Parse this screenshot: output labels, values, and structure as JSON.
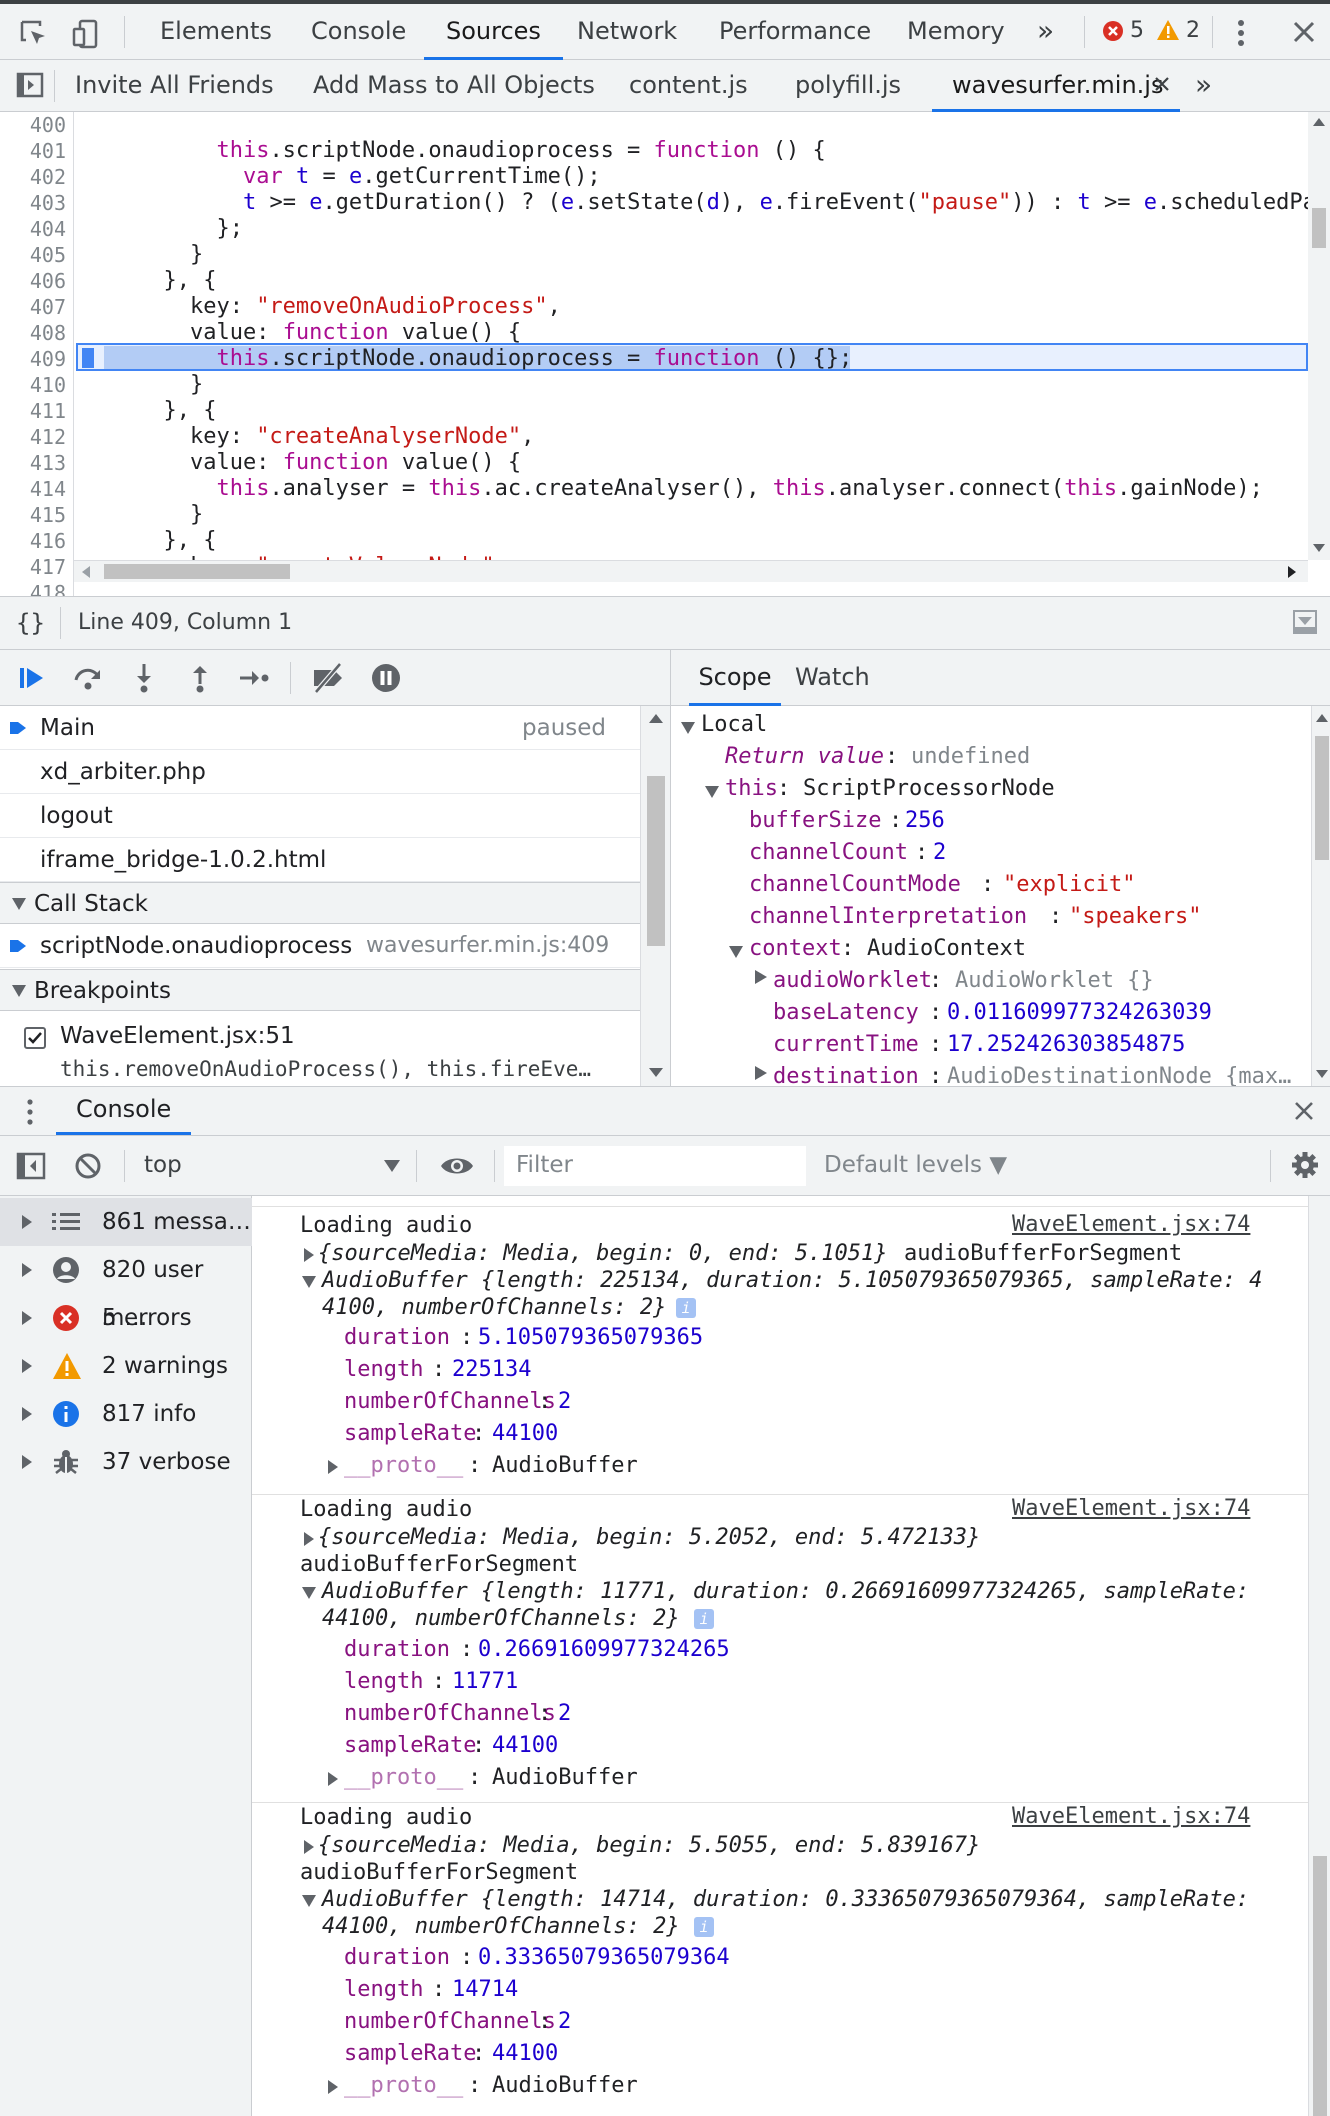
{
  "main_tabs": [
    "Elements",
    "Console",
    "Sources",
    "Network",
    "Performance",
    "Memory"
  ],
  "active_main_tab": "Sources",
  "toolbar": {
    "more_tabs": "»",
    "error_count": "5",
    "warning_count": "2"
  },
  "file_tabs": [
    "Invite All Friends",
    "Add Mass to All Objects",
    "content.js",
    "polyfill.js",
    "wavesurfer.min.js"
  ],
  "active_file_tab": "wavesurfer.min.js",
  "file_tabs_more": "»",
  "editor": {
    "line_numbers": [
      "400",
      "401",
      "402",
      "403",
      "404",
      "405",
      "406",
      "407",
      "408",
      "409",
      "410",
      "411",
      "412",
      "413",
      "414",
      "415",
      "416",
      "417",
      "418"
    ],
    "highlighted_line": "409"
  },
  "status": {
    "position": "Line 409, Column 1"
  },
  "threads": [
    {
      "name": "Main",
      "status": "paused"
    },
    {
      "name": "xd_arbiter.php",
      "status": ""
    },
    {
      "name": "logout",
      "status": ""
    },
    {
      "name": "iframe_bridge-1.0.2.html",
      "status": ""
    }
  ],
  "call_stack": {
    "title": "Call Stack",
    "frames": [
      {
        "function": "scriptNode.onaudioprocess",
        "location": "wavesurfer.min.js:409"
      }
    ]
  },
  "breakpoints": {
    "title": "Breakpoints",
    "items": [
      {
        "file": "WaveElement.jsx:51",
        "code": "this.removeOnAudioProcess(), this.fireEve…",
        "checked": true
      }
    ]
  },
  "scope_tabs": [
    "Scope",
    "Watch"
  ],
  "scope": {
    "local_label": "Local",
    "return_key": "Return value",
    "return_val": "undefined",
    "this_key": "this",
    "this_val": "ScriptProcessorNode",
    "props": [
      {
        "k": "bufferSize",
        "v": "256"
      },
      {
        "k": "channelCount",
        "v": "2"
      },
      {
        "k": "channelCountMode",
        "v": "\"explicit\""
      },
      {
        "k": "channelInterpretation",
        "v": "\"speakers\""
      }
    ],
    "context_key": "context",
    "context_val": "AudioContext",
    "context_props": [
      {
        "k": "audioWorklet",
        "v": "AudioWorklet {}"
      },
      {
        "k": "baseLatency",
        "v": "0.011609977324263039"
      },
      {
        "k": "currentTime",
        "v": "17.252426303854875"
      },
      {
        "k": "destination",
        "v": "AudioDestinationNode {max…"
      }
    ]
  },
  "drawer": {
    "tab": "Console"
  },
  "console_toolbar": {
    "context": "top",
    "filter_placeholder": "Filter",
    "levels": "Default levels ▼"
  },
  "sidebar": [
    {
      "label": "861 messa…",
      "icon": "list-icon"
    },
    {
      "label": "820 user m…",
      "icon": "user-icon"
    },
    {
      "label": "5 errors",
      "icon": "error-icon"
    },
    {
      "label": "2 warnings",
      "icon": "warning-icon"
    },
    {
      "label": "817 info",
      "icon": "info-icon"
    },
    {
      "label": "37 verbose",
      "icon": "bug-icon"
    }
  ],
  "console_messages": [
    {
      "text": "Loading audio",
      "source": "WaveElement.jsx:74",
      "obj_line1": "{sourceMedia: Media, begin: 0, end: 5.1051}",
      "label_inline": "audioBufferForSegment",
      "buffer_line1": "AudioBuffer {length: 225134, duration: 5.105079365079365, sampleRate: 4",
      "buffer_line2": "4100, numberOfChannels: 2}",
      "duration": "5.105079365079365",
      "length": "225134",
      "channels": "2",
      "sampleRate": "44100"
    },
    {
      "text": "Loading audio",
      "source": "WaveElement.jsx:74",
      "obj_line1": "{sourceMedia: Media, begin: 5.2052, end: 5.472133}",
      "label_inline": "audioBufferForSegment",
      "buffer_line1": "AudioBuffer {length: 11771, duration: 0.26691609977324265, sampleRate:",
      "buffer_line2": "44100, numberOfChannels: 2}",
      "duration": "0.26691609977324265",
      "length": "11771",
      "channels": "2",
      "sampleRate": "44100"
    },
    {
      "text": "Loading audio",
      "source": "WaveElement.jsx:74",
      "obj_line1": "{sourceMedia: Media, begin: 5.5055, end: 5.839167}",
      "label_inline": "audioBufferForSegment",
      "buffer_line1": "AudioBuffer {length: 14714, duration: 0.33365079365079364, sampleRate:",
      "buffer_line2": "44100, numberOfChannels: 2}",
      "duration": "0.33365079365079364",
      "length": "14714",
      "channels": "2",
      "sampleRate": "44100"
    }
  ],
  "console_labels": {
    "duration": "duration",
    "length": "length",
    "channels": "numberOfChannels",
    "sampleRate": "sampleRate",
    "proto": "__proto__",
    "proto_val": "AudioBuffer"
  },
  "colors": {
    "accent": "#1a73e8",
    "error": "#d93025",
    "warning": "#f29900",
    "info": "#1a73e8",
    "highlight": "#b3ccf5"
  }
}
